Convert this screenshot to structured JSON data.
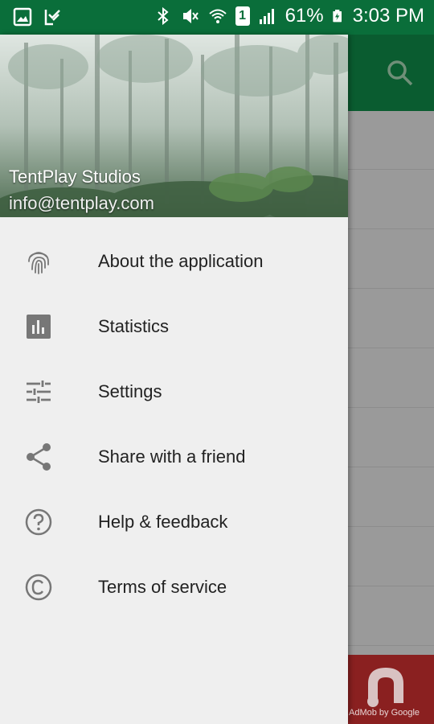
{
  "status_bar": {
    "battery_percent": "61%",
    "time": "3:03 PM",
    "sim_slot": "1"
  },
  "drawer": {
    "header": {
      "name": "TentPlay Studios",
      "email": "info@tentplay.com"
    },
    "items": [
      {
        "label": "About the application",
        "icon": "fingerprint-icon"
      },
      {
        "label": "Statistics",
        "icon": "bar-chart-icon"
      },
      {
        "label": "Settings",
        "icon": "sliders-icon"
      },
      {
        "label": "Share with a friend",
        "icon": "share-icon"
      },
      {
        "label": "Help & feedback",
        "icon": "help-icon"
      },
      {
        "label": "Terms of service",
        "icon": "copyright-icon"
      }
    ]
  },
  "ad": {
    "text": "AdMob by Google"
  },
  "colors": {
    "status_bar": "#0a6e3a",
    "app_bar": "#0a5c30",
    "drawer_bg": "#efefef",
    "ad_bg": "#8a2020"
  }
}
